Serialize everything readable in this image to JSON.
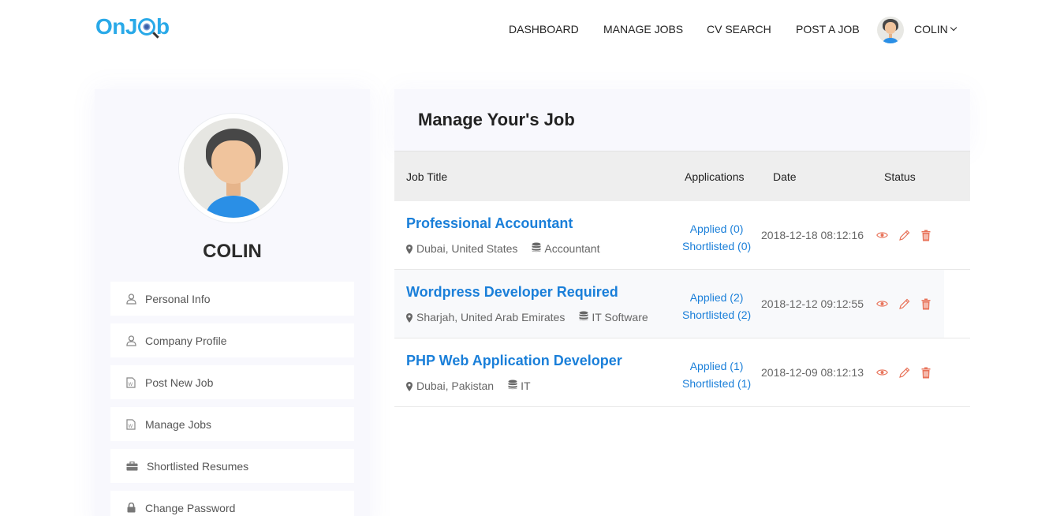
{
  "header": {
    "logo_prefix": "OnJ",
    "logo_suffix": "b",
    "nav": [
      "DASHBOARD",
      "MANAGE JOBS",
      "CV SEARCH",
      "POST A JOB"
    ],
    "user_name": "COLIN"
  },
  "sidebar": {
    "profile_name": "COLIN",
    "items": [
      {
        "label": "Personal Info",
        "icon": "user-icon"
      },
      {
        "label": "Company Profile",
        "icon": "user-icon"
      },
      {
        "label": "Post New Job",
        "icon": "document-icon"
      },
      {
        "label": "Manage Jobs",
        "icon": "document-icon"
      },
      {
        "label": "Shortlisted Resumes",
        "icon": "briefcase-icon"
      },
      {
        "label": "Change Password",
        "icon": "lock-icon"
      }
    ]
  },
  "main": {
    "title": "Manage Your's Job",
    "columns": [
      "Job Title",
      "Applications",
      "Date",
      "Status"
    ],
    "jobs": [
      {
        "title": "Professional Accountant",
        "location": "Dubai, United States",
        "category": "Accountant",
        "applied": "Applied (0)",
        "shortlisted": "Shortlisted (0)",
        "date": "2018-12-18 08:12:16"
      },
      {
        "title": "Wordpress Developer Required",
        "location": "Sharjah, United Arab Emirates",
        "category": "IT Software",
        "applied": "Applied (2)",
        "shortlisted": "Shortlisted (2)",
        "date": "2018-12-12 09:12:55"
      },
      {
        "title": "PHP Web Application Developer",
        "location": "Dubai, Pakistan",
        "category": "IT",
        "applied": "Applied (1)",
        "shortlisted": "Shortlisted (1)",
        "date": "2018-12-09 08:12:13"
      }
    ]
  },
  "colors": {
    "accent": "#1a7fd9",
    "logo": "#29a9e8",
    "action": "#e8735a"
  }
}
